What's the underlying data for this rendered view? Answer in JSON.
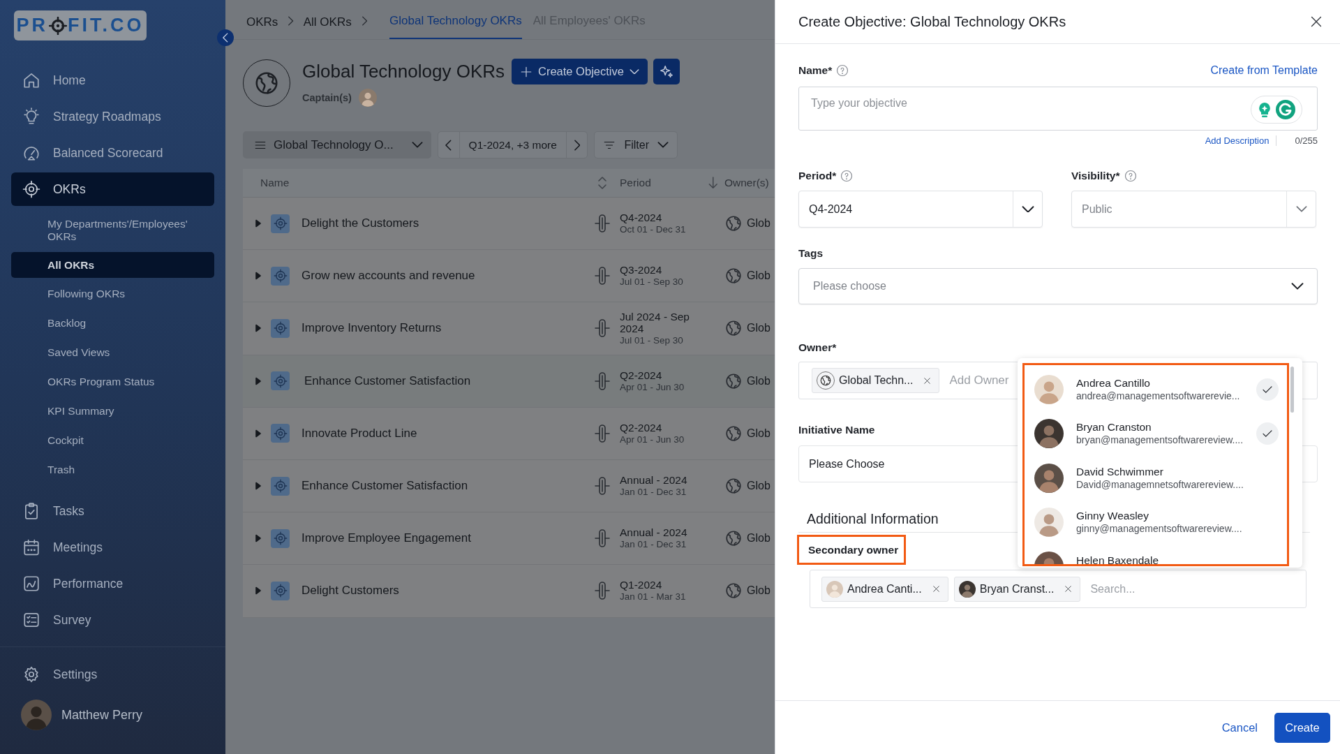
{
  "sidebar": {
    "logo_parts": [
      "PR",
      "FIT.CO"
    ],
    "items": [
      {
        "label": "Home",
        "selected": false
      },
      {
        "label": "Strategy Roadmaps",
        "selected": false
      },
      {
        "label": "Balanced Scorecard",
        "selected": false
      },
      {
        "label": "OKRs",
        "selected": true,
        "children": [
          {
            "label": "My Departments'/Employees' OKRs",
            "selected": false
          },
          {
            "label": "All OKRs",
            "selected": true
          },
          {
            "label": "Following OKRs",
            "selected": false
          },
          {
            "label": "Backlog",
            "selected": false
          },
          {
            "label": "Saved Views",
            "selected": false
          },
          {
            "label": "OKRs Program Status",
            "selected": false
          },
          {
            "label": "KPI Summary",
            "selected": false
          },
          {
            "label": "Cockpit",
            "selected": false
          },
          {
            "label": "Trash",
            "selected": false
          }
        ]
      },
      {
        "label": "Tasks",
        "selected": false
      },
      {
        "label": "Meetings",
        "selected": false
      },
      {
        "label": "Performance",
        "selected": false
      },
      {
        "label": "Survey",
        "selected": false
      }
    ],
    "settings": "Settings",
    "user": {
      "name": "Matthew Perry"
    }
  },
  "breadcrumbs": [
    "OKRs",
    "All OKRs"
  ],
  "tabs": [
    {
      "label": "Global Technology OKRs",
      "selected": true
    },
    {
      "label": "All Employees' OKRs",
      "selected": false
    }
  ],
  "header": {
    "title": "Global Technology OKRs",
    "captains_label": "Captain(s)",
    "create_button": "Create Objective"
  },
  "toolbar": {
    "view": "Global Technology O...",
    "period": "Q1-2024, +3 more",
    "filter": "Filter"
  },
  "table": {
    "columns": [
      "Name",
      "Period",
      "Owner(s)"
    ],
    "rows": [
      {
        "name": "Delight the Customers",
        "period": "Q4-2024",
        "dates": "Oct 01 - Dec 31",
        "owner": "Glob",
        "highlighted": false
      },
      {
        "name": "Grow new accounts and revenue",
        "period": "Q3-2024",
        "dates": "Jul 01 - Sep 30",
        "owner": "Glob",
        "highlighted": false
      },
      {
        "name": "Improve Inventory Returns",
        "period": "Jul 2024 - Sep 2024",
        "dates": "Jul 01 - Sep 30",
        "owner": "Glob",
        "highlighted": false
      },
      {
        "name": "Enhance Customer Satisfaction",
        "period": "Q2-2024",
        "dates": "Apr 01 - Jun 30",
        "owner": "Glob",
        "highlighted": true
      },
      {
        "name": "Innovate Product Line",
        "period": "Q2-2024",
        "dates": "Apr 01 - Jun 30",
        "owner": "Glob",
        "highlighted": false
      },
      {
        "name": "Enhance Customer Satisfaction",
        "period": "Annual - 2024",
        "dates": "Jan 01 - Dec 31",
        "owner": "Glob",
        "highlighted": false
      },
      {
        "name": "Improve Employee Engagement",
        "period": "Annual - 2024",
        "dates": "Jan 01 - Dec 31",
        "owner": "Glob",
        "highlighted": false
      },
      {
        "name": "Delight Customers",
        "period": "Q1-2024",
        "dates": "Jan 01 - Mar 31",
        "owner": "Glob",
        "highlighted": false
      }
    ]
  },
  "panel": {
    "title": "Create Objective: Global Technology OKRs",
    "name_label": "Name*",
    "template_link": "Create from Template",
    "name_placeholder": "Type your objective",
    "add_description": "Add Description",
    "char_count": "0/255",
    "period_label": "Period*",
    "period_value": "Q4-2024",
    "visibility_label": "Visibility*",
    "visibility_value": "Public",
    "tags_label": "Tags",
    "tags_placeholder": "Please choose",
    "owner_label": "Owner*",
    "owner_chips": [
      "Global Techn..."
    ],
    "owner_placeholder": "Add Owner",
    "initiative_label": "Initiative Name",
    "initiative_value": "Please Choose",
    "section_title": "Additional Information",
    "secondary_owner_label": "Secondary owner",
    "secondary_owner_highlighted": true,
    "secondary_chips": [
      "Andrea Canti...",
      "Bryan Cranst..."
    ],
    "secondary_placeholder": "Search...",
    "cancel_button": "Cancel",
    "create_button": "Create"
  },
  "owner_dropdown": {
    "highlighted": true,
    "options": [
      {
        "name": "Andrea Cantillo",
        "email": "andrea@managementsoftwarerevie...",
        "checked": true
      },
      {
        "name": "Bryan Cranston",
        "email": "bryan@managementsoftwarereview....",
        "checked": true
      },
      {
        "name": "David Schwimmer",
        "email": "David@managemnetsoftwarereview....",
        "checked": false
      },
      {
        "name": "Ginny Weasley",
        "email": "ginny@managementsoftwarereview....",
        "checked": false
      },
      {
        "name": "Helen Baxendale",
        "checked": false
      }
    ]
  }
}
